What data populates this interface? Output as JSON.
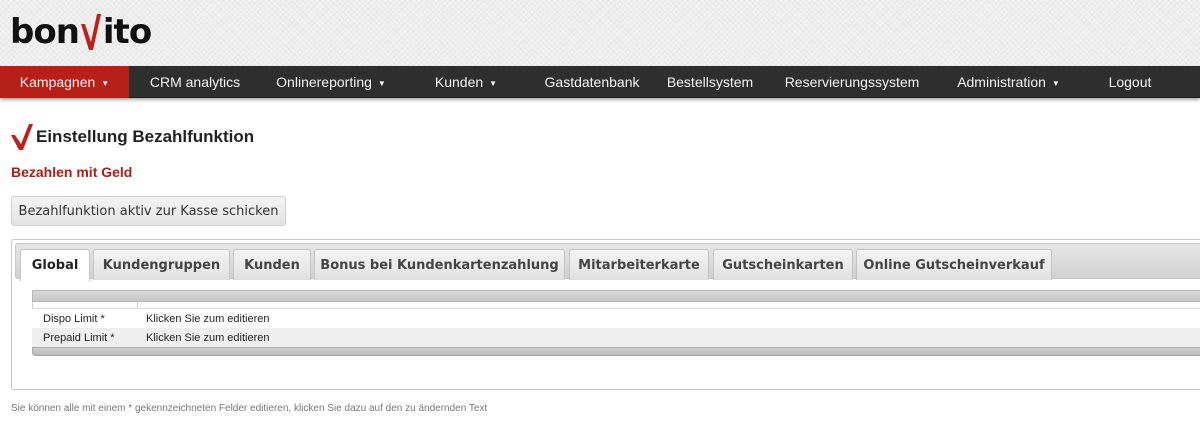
{
  "brand": {
    "logo_before": "bon",
    "logo_after": "ito",
    "accent": "#b81f18"
  },
  "nav": {
    "items": [
      {
        "label": "Kampagnen",
        "dropdown": true,
        "active": true
      },
      {
        "label": "CRM analytics",
        "dropdown": false
      },
      {
        "label": "Onlinereporting",
        "dropdown": true
      },
      {
        "label": "Kunden",
        "dropdown": true
      },
      {
        "label": "Gastdatenbank",
        "dropdown": false
      },
      {
        "label": "Bestellsystem",
        "dropdown": false
      },
      {
        "label": "Reservierungssystem",
        "dropdown": false
      },
      {
        "label": "Administration",
        "dropdown": true
      },
      {
        "label": "Logout",
        "dropdown": false
      }
    ],
    "caret": "▼"
  },
  "page": {
    "title": "Einstellung Bezahlfunktion",
    "subtitle": "Bezahlen mit Geld",
    "action_button": "Bezahlfunktion aktiv zur Kasse schicken"
  },
  "tabs": [
    {
      "label": "Global",
      "active": true
    },
    {
      "label": "Kundengruppen"
    },
    {
      "label": "Kunden"
    },
    {
      "label": "Bonus bei Kundenkartenzahlung"
    },
    {
      "label": "Mitarbeiterkarte"
    },
    {
      "label": "Gutscheinkarten"
    },
    {
      "label": "Online Gutscheinverkauf"
    }
  ],
  "grid": {
    "rows": [
      {
        "label": "Dispo Limit *",
        "value": "Klicken Sie zum editieren"
      },
      {
        "label": "Prepaid Limit *",
        "value": "Klicken Sie zum editieren"
      }
    ]
  },
  "footnote": "Sie können alle mit einem * gekennzeichneten Felder editieren, klicken Sie dazu auf den zu ändernden Text"
}
